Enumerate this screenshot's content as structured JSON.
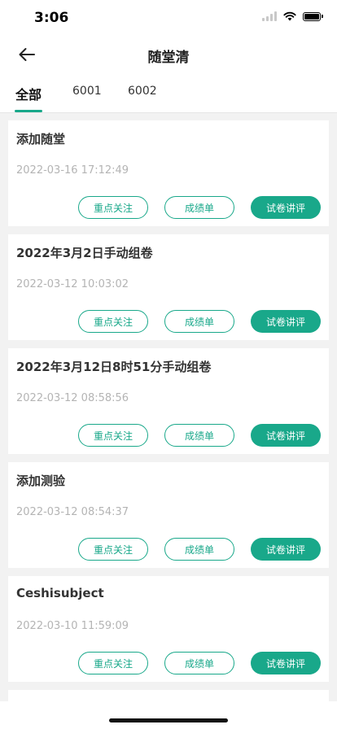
{
  "status_bar": {
    "time": "3:06"
  },
  "header": {
    "title": "随堂清"
  },
  "tabs": [
    {
      "label": "全部",
      "active": true
    },
    {
      "label": "6001",
      "active": false
    },
    {
      "label": "6002",
      "active": false
    }
  ],
  "buttons": {
    "focus": "重点关注",
    "report": "成绩单",
    "review": "试卷讲评"
  },
  "items": [
    {
      "title": "添加随堂",
      "date": "2022-03-16 17:12:49"
    },
    {
      "title": "2022年3月2日手动组卷",
      "date": "2022-03-12 10:03:02"
    },
    {
      "title": "2022年3月12日8时51分手动组卷",
      "date": "2022-03-12 08:58:56"
    },
    {
      "title": "添加测验",
      "date": "2022-03-12 08:54:37"
    },
    {
      "title": "Ceshisubject",
      "date": "2022-03-10 11:59:09"
    }
  ],
  "colors": {
    "accent": "#19a88a",
    "background": "#f2f2f2"
  },
  "icons": {
    "back": "arrow-left-icon",
    "wifi": "wifi-icon",
    "battery": "battery-icon",
    "signal": "signal-icon"
  }
}
